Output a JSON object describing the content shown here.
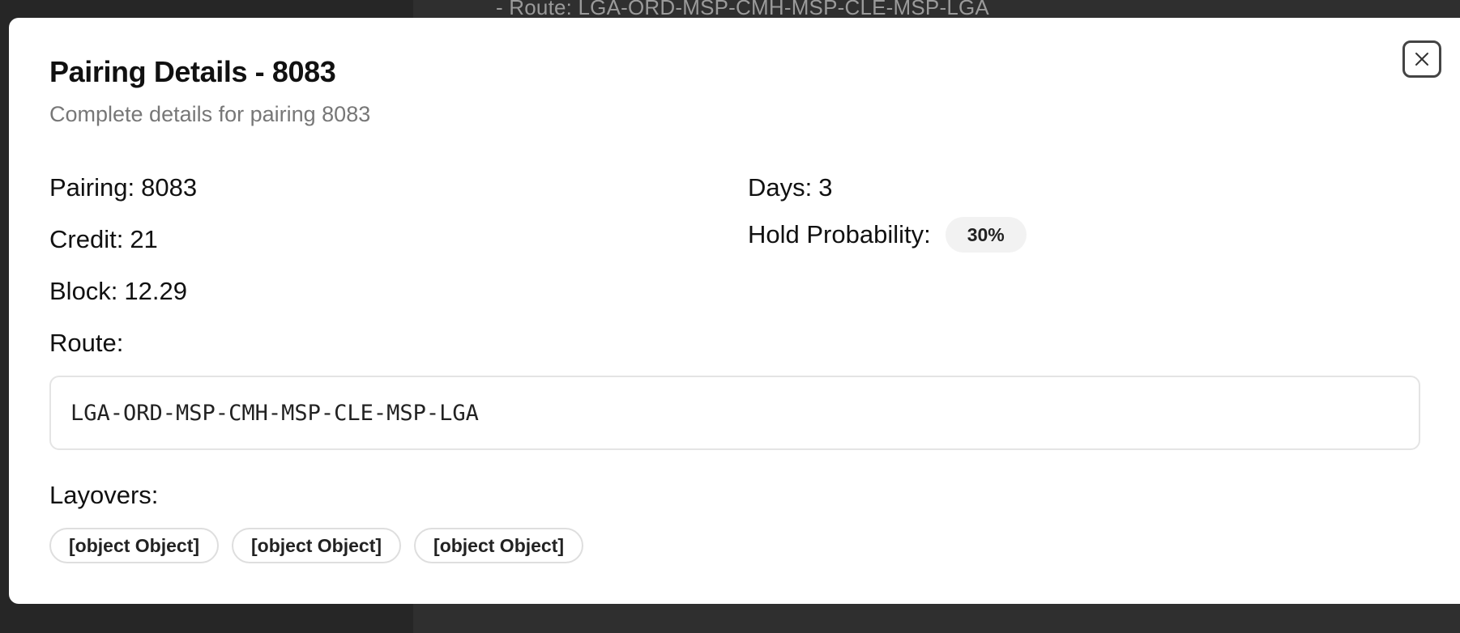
{
  "background": {
    "text": "- Route: LGA-ORD-MSP-CMH-MSP-CLE-MSP-LGA"
  },
  "dialog": {
    "title": "Pairing Details - 8083",
    "subtitle": "Complete details for pairing 8083",
    "close_icon": "close-icon"
  },
  "details": {
    "pairing": {
      "label": "Pairing:",
      "value": "8083"
    },
    "days": {
      "label": "Days:",
      "value": "3"
    },
    "credit": {
      "label": "Credit:",
      "value": "21"
    },
    "hold_probability": {
      "label": "Hold Probability:",
      "value": "30%"
    },
    "block": {
      "label": "Block:",
      "value": "12.29"
    }
  },
  "route": {
    "label": "Route:",
    "value": "LGA-ORD-MSP-CMH-MSP-CLE-MSP-LGA"
  },
  "layovers": {
    "label": "Layovers:",
    "items": [
      "[object Object]",
      "[object Object]",
      "[object Object]"
    ]
  },
  "colors": {
    "overlay": "#2f2f2f",
    "modal": "#ffffff",
    "badge_bg": "#f2f2f2"
  }
}
